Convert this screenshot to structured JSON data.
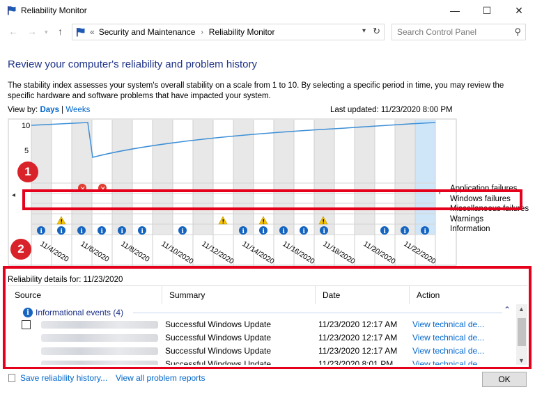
{
  "window": {
    "title": "Reliability Monitor",
    "minimize": "—",
    "maximize": "☐",
    "close": "✕"
  },
  "address": {
    "overflow": "«",
    "crumbs": [
      "Security and Maintenance",
      "Reliability Monitor"
    ],
    "search_placeholder": "Search Control Panel"
  },
  "page": {
    "heading": "Review your computer's reliability and problem history",
    "description": "The stability index assesses your system's overall stability on a scale from 1 to 10. By selecting a specific period in time, you may review the specific hardware and software problems that have impacted your system.",
    "view_by_label": "View by:",
    "view_days": "Days",
    "view_separator": "|",
    "view_weeks": "Weeks",
    "last_updated": "Last updated: 11/23/2020 8:00 PM"
  },
  "chart": {
    "y_ticks": [
      "10",
      "5"
    ],
    "row_labels": [
      "Application failures",
      "Windows failures",
      "Miscellaneous failures",
      "Warnings",
      "Information"
    ],
    "date_labels": [
      "11/4/2020",
      "11/6/2020",
      "11/8/2020",
      "11/10/2020",
      "11/12/2020",
      "11/14/2020",
      "11/16/2020",
      "11/18/2020",
      "11/20/2020",
      "11/22/2020"
    ],
    "nav_left": "◂",
    "nav_right": "›",
    "colors": {
      "line": "#3d8fd6",
      "error": "#e03c31",
      "warning": "#f5c400",
      "info": "#1565c0",
      "selected": "#cfe6f9",
      "shade": "#e8e8e8"
    }
  },
  "callouts": {
    "one": "1",
    "two": "2"
  },
  "details": {
    "title": "Reliability details for: 11/23/2020",
    "columns": [
      "Source",
      "Summary",
      "Date",
      "Action"
    ],
    "group_label": "Informational events (4)",
    "group_toggle": "⌃",
    "rows": [
      {
        "summary": "Successful Windows Update",
        "date": "11/23/2020 12:17 AM",
        "action": "View technical de..."
      },
      {
        "summary": "Successful Windows Update",
        "date": "11/23/2020 12:17 AM",
        "action": "View technical de..."
      },
      {
        "summary": "Successful Windows Update",
        "date": "11/23/2020 12:17 AM",
        "action": "View technical de..."
      },
      {
        "summary": "Successful Windows Update",
        "date": "11/23/2020 8:01 PM",
        "action": "View technical de..."
      }
    ]
  },
  "footer": {
    "save": "Save reliability history...",
    "view_all": "View all problem reports",
    "ok": "OK"
  }
}
